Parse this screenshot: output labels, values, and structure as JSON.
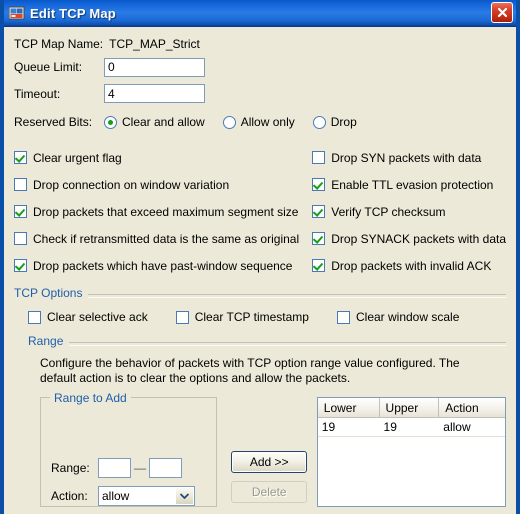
{
  "window": {
    "title": "Edit TCP Map",
    "app_icon": "tcp-map-icon",
    "close_label": "✕",
    "accent_title_bar": "#1567DB",
    "face_color": "#ECE9D8",
    "group_label_color": "#1F5FA9",
    "check_color": "#169E16"
  },
  "form": {
    "map_name_label": "TCP Map Name:",
    "map_name_value": "TCP_MAP_Strict",
    "queue_limit_label": "Queue Limit:",
    "queue_limit_value": "0",
    "timeout_label": "Timeout:",
    "timeout_value": "4",
    "reserved_bits_label": "Reserved Bits:",
    "reserved_bits_options": [
      {
        "label": "Clear and allow",
        "selected": true
      },
      {
        "label": "Allow only",
        "selected": false
      },
      {
        "label": "Drop",
        "selected": false
      }
    ]
  },
  "checkboxes_left": [
    {
      "label": "Clear urgent flag",
      "checked": true
    },
    {
      "label": "Drop connection on window variation",
      "checked": false
    },
    {
      "label": "Drop packets that exceed maximum segment size",
      "checked": true
    },
    {
      "label": "Check if retransmitted data is the same as original",
      "checked": false
    },
    {
      "label": "Drop packets which have past-window sequence",
      "checked": true
    }
  ],
  "checkboxes_right": [
    {
      "label": "Drop SYN packets with data",
      "checked": false
    },
    {
      "label": "Enable TTL evasion protection",
      "checked": true
    },
    {
      "label": "Verify TCP checksum",
      "checked": true
    },
    {
      "label": "Drop SYNACK packets with data",
      "checked": true
    },
    {
      "label": "Drop packets with invalid ACK",
      "checked": true
    }
  ],
  "tcp_options": {
    "group_title": "TCP Options",
    "items": [
      {
        "label": "Clear selective ack",
        "checked": false
      },
      {
        "label": "Clear TCP timestamp",
        "checked": false
      },
      {
        "label": "Clear window scale",
        "checked": false
      }
    ]
  },
  "range": {
    "group_title": "Range",
    "description": "Configure the behavior of packets with TCP option range value configured. The default action is to clear the options and allow the packets.",
    "range_to_add": {
      "title": "Range to Add",
      "range_label": "Range:",
      "range_from_value": "",
      "range_to_value": "",
      "range_separator": "—",
      "action_label": "Action:",
      "action_value": "allow"
    },
    "buttons": {
      "add_label": "Add >>",
      "delete_label": "Delete",
      "delete_disabled": true
    },
    "table": {
      "columns": [
        "Lower",
        "Upper",
        "Action"
      ],
      "rows": [
        {
          "lower": "19",
          "upper": "19",
          "action": "allow"
        }
      ]
    }
  }
}
